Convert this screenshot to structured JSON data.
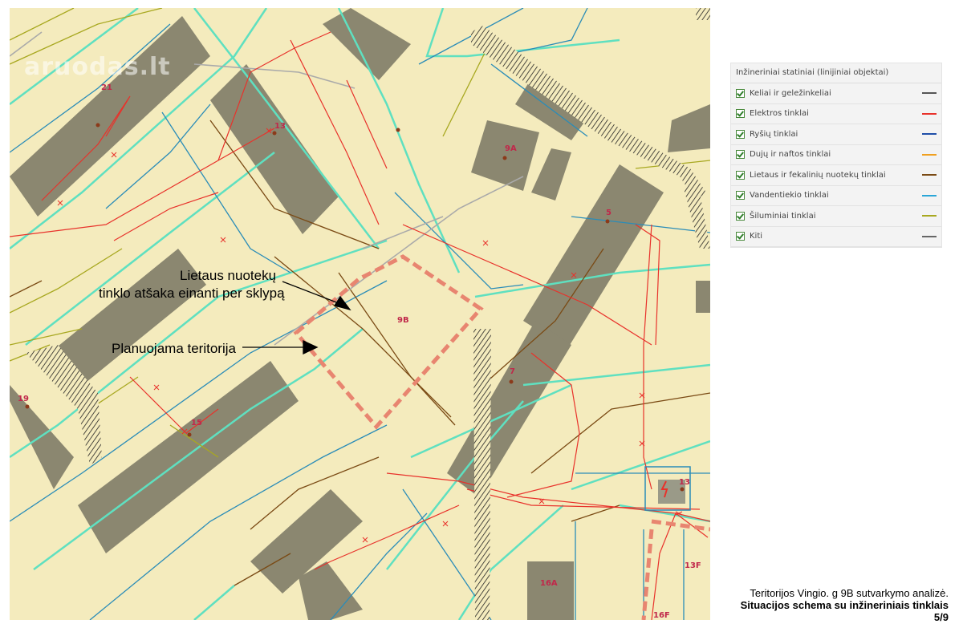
{
  "watermark": "aruodas.lt",
  "annotations": {
    "drain_line_1": "Lietaus nuotekų",
    "drain_line_2": "tinklo atšaka einanti per sklypą",
    "planned_area": "Planuojama teritorija"
  },
  "building_labels": [
    "21",
    "13",
    "9A",
    "5",
    "9B",
    "7",
    "19",
    "15",
    "13",
    "16A",
    "13F",
    "16F"
  ],
  "legend": {
    "title": "Inžineriniai statiniai (linijiniai objektai)",
    "items": [
      {
        "label": "Keliai ir geležinkeliai",
        "color": "#555555"
      },
      {
        "label": "Elektros tinklai",
        "color": "#e8322b"
      },
      {
        "label": "Ryšių tinklai",
        "color": "#1f4fa8"
      },
      {
        "label": "Dujų ir naftos tinklai",
        "color": "#f0a020"
      },
      {
        "label": "Lietaus ir fekalinių nuotekų tinklai",
        "color": "#7a4a14"
      },
      {
        "label": "Vandentiekio tinklai",
        "color": "#2aa6d8"
      },
      {
        "label": "Šiluminiai tinklai",
        "color": "#a8a820"
      },
      {
        "label": "Kiti",
        "color": "#666666"
      }
    ]
  },
  "caption": {
    "line1": "Teritorijos Vingio. g 9B sutvarkymo analizė.",
    "line2": "Situacijos schema su inžineriniais tinklais",
    "line3": "5/9"
  },
  "colors": {
    "map_background": "#f4ebbd",
    "building": "#8b8770",
    "parcel_outline": "#e88570",
    "teal_lines": "#5fe0c0",
    "blue_lines": "#2a8cb8"
  }
}
